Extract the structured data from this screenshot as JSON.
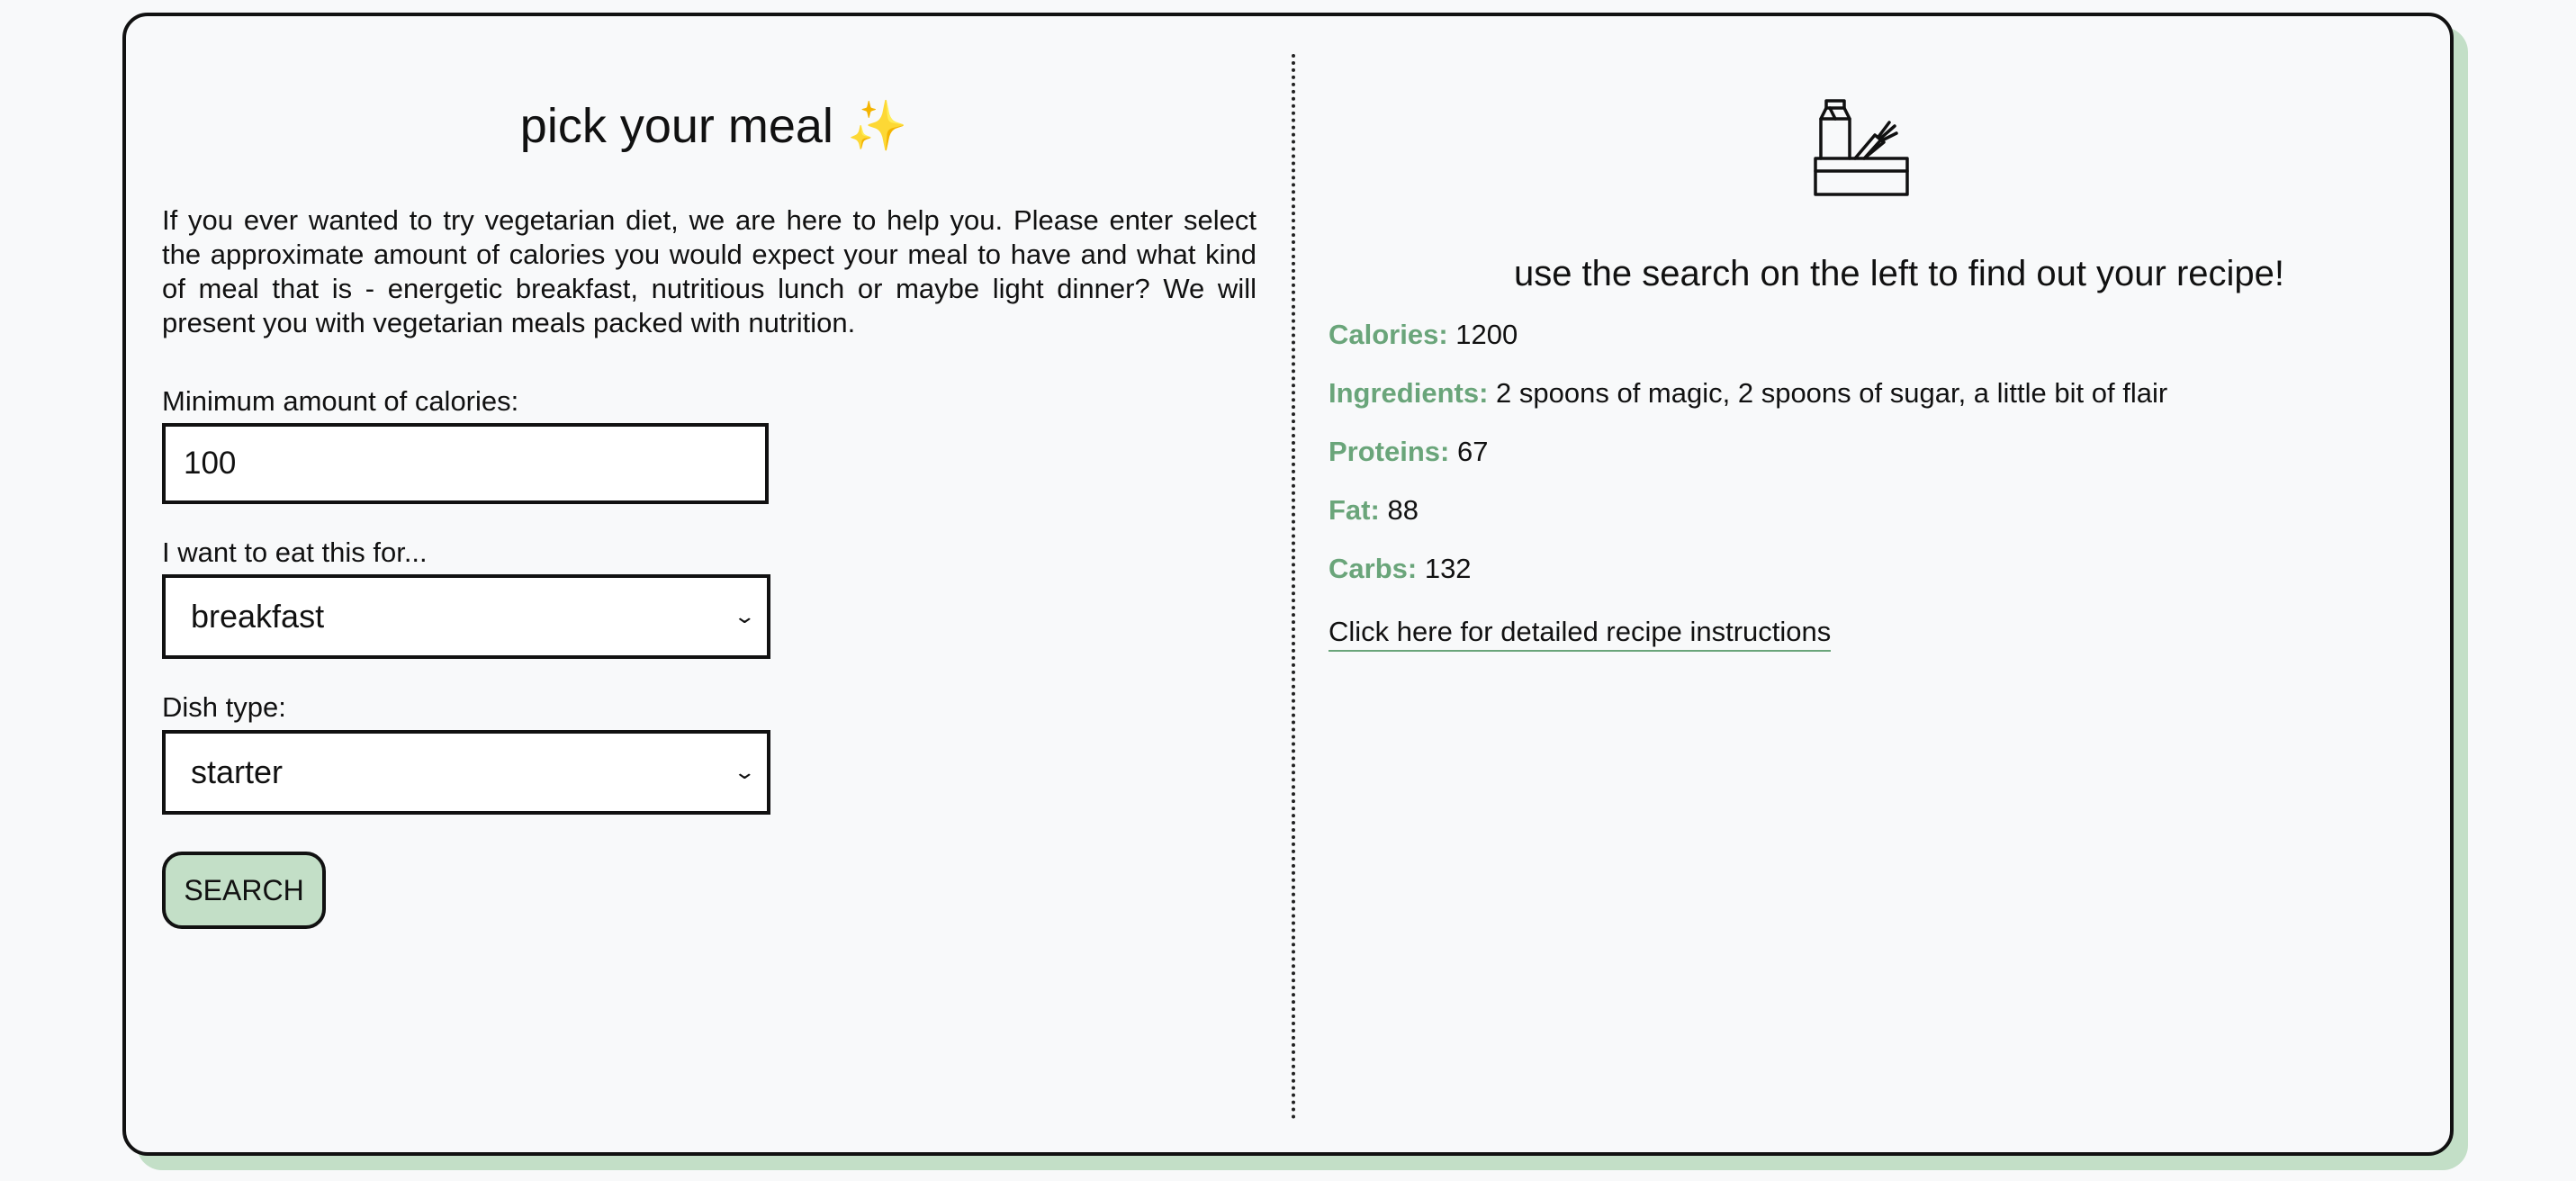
{
  "app": {
    "title": "pick your meal",
    "title_emoji": "✨",
    "intro": "If you ever wanted to try vegetarian diet, we are here to help you. Please enter select the approximate amount of calories you would expect your meal to have and what kind of meal that is - energetic breakfast, nutritious lunch or maybe light dinner? We will present you with vegetarian meals packed with nutrition."
  },
  "form": {
    "calories_label": "Minimum amount of calories:",
    "calories_value": "100",
    "meal_label": "I want to eat this for...",
    "meal_selected": "breakfast",
    "dish_label": "Dish type:",
    "dish_selected": "starter",
    "search_label": "SEARCH"
  },
  "result": {
    "heading": "use the search on the left to find out your recipe!",
    "icon": "groceries-icon",
    "calories_key": "Calories:",
    "calories_value": "1200",
    "ingredients_key": "Ingredients:",
    "ingredients_value": "2 spoons of magic, 2 spoons of sugar, a little bit of flair",
    "proteins_key": "Proteins:",
    "proteins_value": "67",
    "fat_key": "Fat:",
    "fat_value": "88",
    "carbs_key": "Carbs:",
    "carbs_value": "132",
    "link_text": "Click here for detailed recipe instructions"
  },
  "colors": {
    "accent": "#c3dfc7",
    "label_green": "#6aa57a",
    "border": "#111111",
    "background": "#f8f9fa"
  }
}
